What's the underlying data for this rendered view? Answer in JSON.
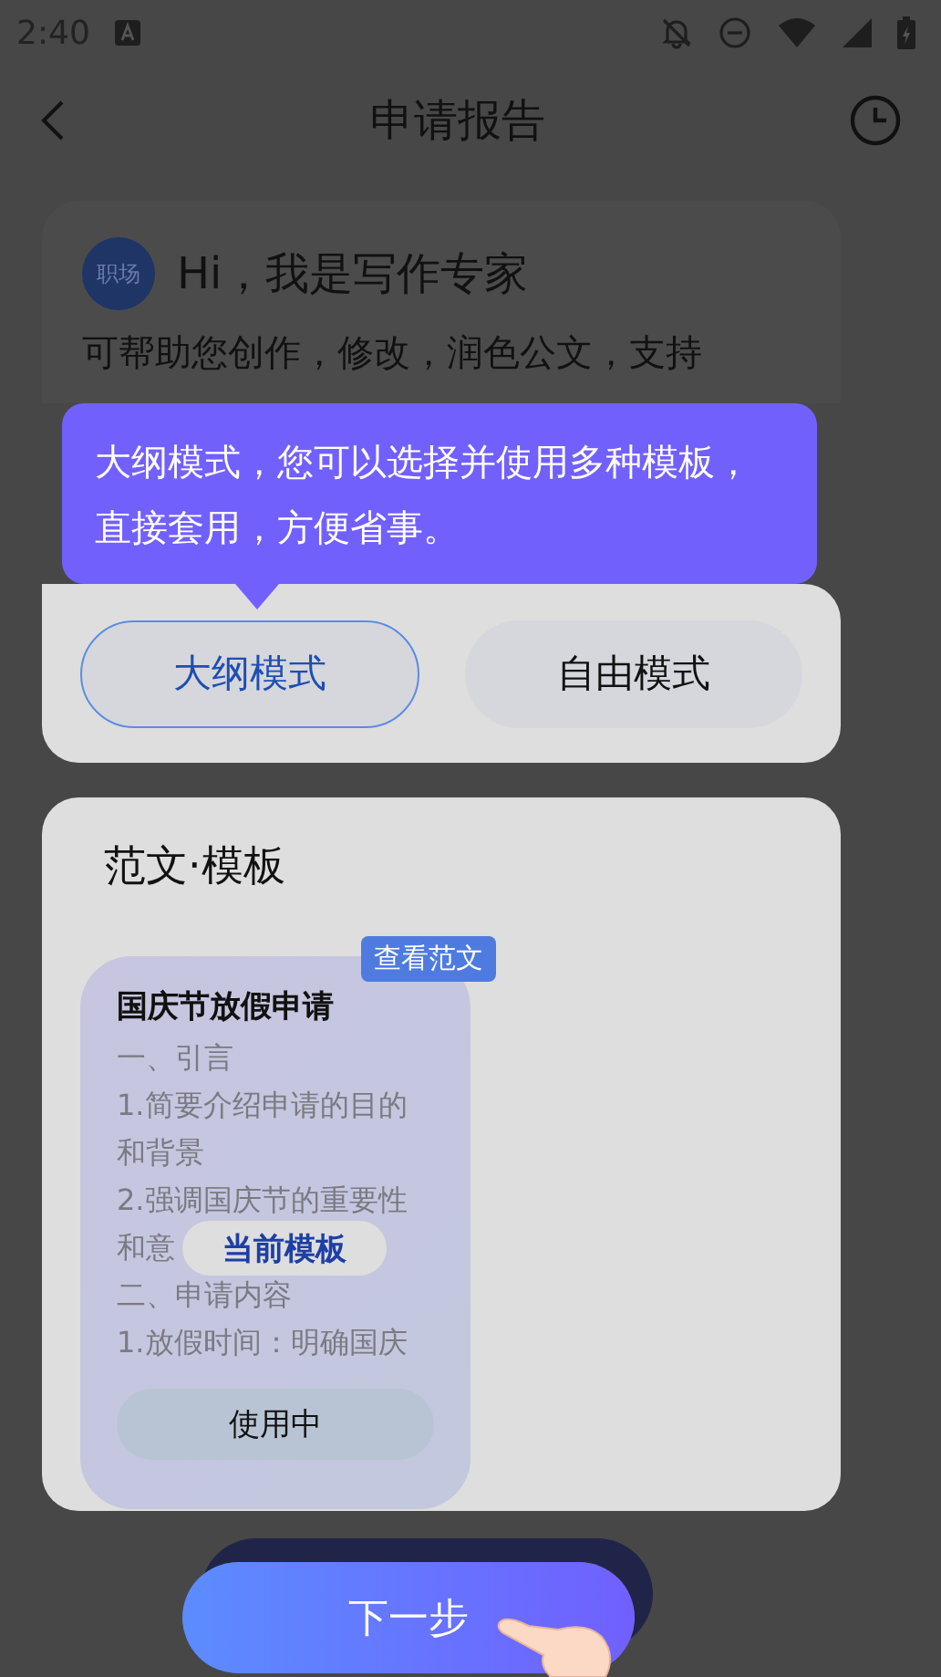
{
  "status_bar": {
    "time": "2:40"
  },
  "nav": {
    "title": "申请报告"
  },
  "intro": {
    "avatar": "职场",
    "heading": "Hi，我是写作专家",
    "body": "可帮助您创作，修改，润色公文，支持"
  },
  "tooltip": {
    "text": "大纲模式，您可以选择并使用多种模板，直接套用，方便省事。"
  },
  "modes": [
    {
      "label": "大纲模式",
      "selected": true
    },
    {
      "label": "自由模式",
      "selected": false
    }
  ],
  "templates": {
    "title": "范文·模板",
    "items": [
      {
        "badge": "查看范文",
        "title": "国庆节放假申请",
        "lines": [
          {
            "text": "一、引言"
          },
          {
            "text": "1.简要介绍申请的目的"
          },
          {
            "text": "和背景"
          },
          {
            "text": "2.强调国庆节的重要性"
          },
          {
            "text": "和意",
            "overlay": "当前模板"
          },
          {
            "text": "二、申请内容"
          },
          {
            "text": "1.放假时间：明确国庆"
          }
        ],
        "action": "使用中"
      }
    ]
  },
  "next_button": {
    "label": "下一步"
  }
}
